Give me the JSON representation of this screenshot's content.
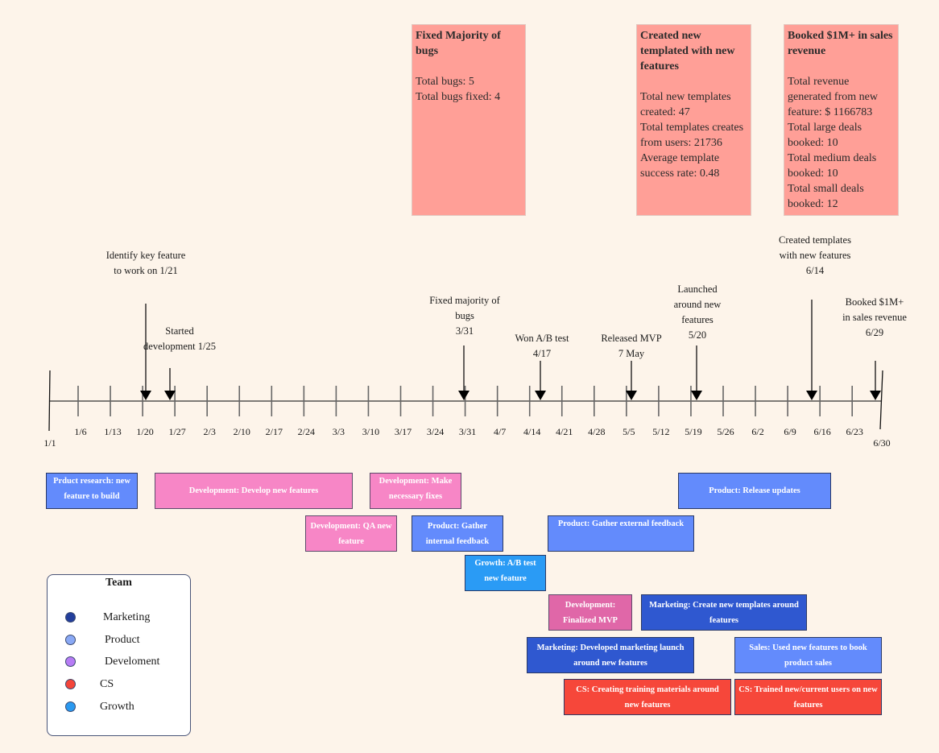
{
  "cards": [
    {
      "title": "Fixed Majority of bugs",
      "lines": [
        "Total bugs: 5",
        "Total bugs fixed: 4"
      ]
    },
    {
      "title": "Created new templated with new features",
      "lines": [
        "Total new templates created: 47",
        "Total templates creates from users: 21736",
        "Average template success rate: 0.48"
      ]
    },
    {
      "title": "Booked $1M+ in sales revenue",
      "lines": [
        "Total revenue generated from new feature: $ 1166783",
        "Total large deals booked: 10",
        "Total medium deals booked: 10",
        "Total small deals booked: 12"
      ]
    }
  ],
  "timeline": {
    "start_label": "1/1",
    "end_label": "6/30",
    "ticks": [
      "1/6",
      "1/13",
      "1/20",
      "1/27",
      "2/3",
      "2/10",
      "2/17",
      "2/24",
      "3/3",
      "3/10",
      "3/17",
      "3/24",
      "3/31",
      "4/7",
      "4/14",
      "4/21",
      "4/28",
      "5/5",
      "5/12",
      "5/19",
      "5/26",
      "6/2",
      "6/9",
      "6/16",
      "6/23"
    ]
  },
  "milestones": [
    {
      "line1": "Identify key feature",
      "line2": "to work on 1/21",
      "line3": ""
    },
    {
      "line1": "Started",
      "line2": "development 1/25",
      "line3": ""
    },
    {
      "line1": "Fixed majority of",
      "line2": "bugs",
      "line3": "3/31"
    },
    {
      "line1": "Won A/B test",
      "line2": "4/17",
      "line3": ""
    },
    {
      "line1": "Released MVP",
      "line2": "7 May",
      "line3": ""
    },
    {
      "line1": "Launched",
      "line2": "around new",
      "line3": "features",
      "line4": "5/20"
    },
    {
      "line1": "Created templates",
      "line2": "with new features",
      "line3": "6/14"
    },
    {
      "line1": "Booked $1M+",
      "line2": "in sales revenue",
      "line3": "6/29"
    }
  ],
  "tasks": [
    {
      "label": "Prduct research: new feature to build",
      "team": "Product"
    },
    {
      "label": "Development: Develop new features",
      "team": "Development"
    },
    {
      "label": "Development: Make necessary fixes",
      "team": "Development"
    },
    {
      "label": "Product: Release updates",
      "team": "Product"
    },
    {
      "label": "Development: QA new feature",
      "team": "Development"
    },
    {
      "label": "Product: Gather internal feedback",
      "team": "Product"
    },
    {
      "label": "Product: Gather external feedback",
      "team": "Product"
    },
    {
      "label": "Growth: A/B test new feature",
      "team": "Growth"
    },
    {
      "label": "Development: Finalized MVP",
      "team": "Development"
    },
    {
      "label": "Marketing: Create new templates around features",
      "team": "Marketing"
    },
    {
      "label": "Marketing: Developed marketing launch around new features",
      "team": "Marketing"
    },
    {
      "label": "Sales: Used new features to book product sales",
      "team": "Product"
    },
    {
      "label": "CS: Creating training materials around new features",
      "team": "CS"
    },
    {
      "label": "CS: Trained new/current users on new features",
      "team": "CS"
    }
  ],
  "legend": {
    "title": "Team",
    "items": [
      {
        "label": "Marketing",
        "color": "#233f9c"
      },
      {
        "label": "Product",
        "color": "#8aa9f5"
      },
      {
        "label": "Develoment",
        "color": "#b77cf5"
      },
      {
        "label": "CS",
        "color": "#f4453a"
      },
      {
        "label": "Growth",
        "color": "#2a99f0"
      }
    ]
  },
  "colors": {
    "product": "#638bfc",
    "development": "#f786c6",
    "development_mvp": "#e067a8",
    "growth": "#2a9bf5",
    "marketing": "#2f58d0",
    "cs": "#f6473a",
    "card": "#ff9f97",
    "background": "#fdf4ea"
  }
}
